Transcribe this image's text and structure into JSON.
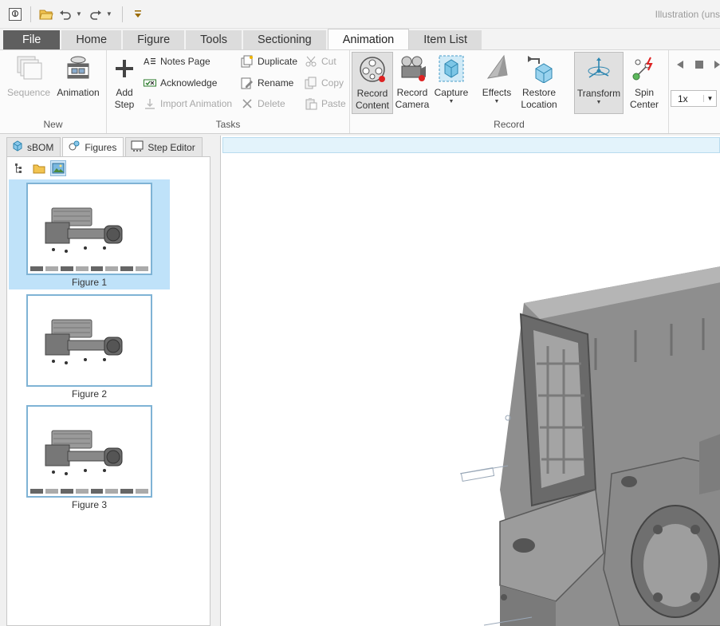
{
  "window": {
    "title": "Illustration (uns"
  },
  "quick_access": {
    "items": [
      "app-icon",
      "open-icon",
      "undo-icon",
      "redo-icon",
      "customize-icon"
    ]
  },
  "tabs": [
    {
      "label": "File"
    },
    {
      "label": "Home"
    },
    {
      "label": "Figure"
    },
    {
      "label": "Tools"
    },
    {
      "label": "Sectioning"
    },
    {
      "label": "Animation",
      "active": true
    },
    {
      "label": "Item List"
    }
  ],
  "ribbon": {
    "groups": {
      "new": "New",
      "tasks": "Tasks",
      "record": "Record"
    },
    "new": {
      "sequence": "Sequence",
      "animation": "Animation"
    },
    "tasks": {
      "add_step_line1": "Add",
      "add_step_line2": "Step",
      "notes_page": "Notes Page",
      "acknowledge": "Acknowledge",
      "import_animation": "Import Animation",
      "duplicate": "Duplicate",
      "rename": "Rename",
      "delete": "Delete",
      "cut": "Cut",
      "copy": "Copy",
      "paste": "Paste"
    },
    "record": {
      "record_content_line1": "Record",
      "record_content_line2": "Content",
      "record_camera_line1": "Record",
      "record_camera_line2": "Camera",
      "capture": "Capture",
      "effects": "Effects",
      "restore_location_line1": "Restore",
      "restore_location_line2": "Location",
      "transform": "Transform",
      "spin_center_line1": "Spin",
      "spin_center_line2": "Center"
    },
    "playback": {
      "speed": "1x"
    }
  },
  "left_panel": {
    "tabs": [
      {
        "label": "sBOM",
        "icon": "sbom-icon"
      },
      {
        "label": "Figures",
        "icon": "figures-icon",
        "active": true
      },
      {
        "label": "Step Editor",
        "icon": "step-editor-icon"
      }
    ],
    "figures": [
      {
        "label": "Figure 1",
        "selected": true
      },
      {
        "label": "Figure 2"
      },
      {
        "label": "Figure 3"
      }
    ]
  },
  "colors": {
    "accent": "#5f5f5f",
    "selection": "#bfe2f9",
    "viewport_bar": "#e3f3fb"
  }
}
